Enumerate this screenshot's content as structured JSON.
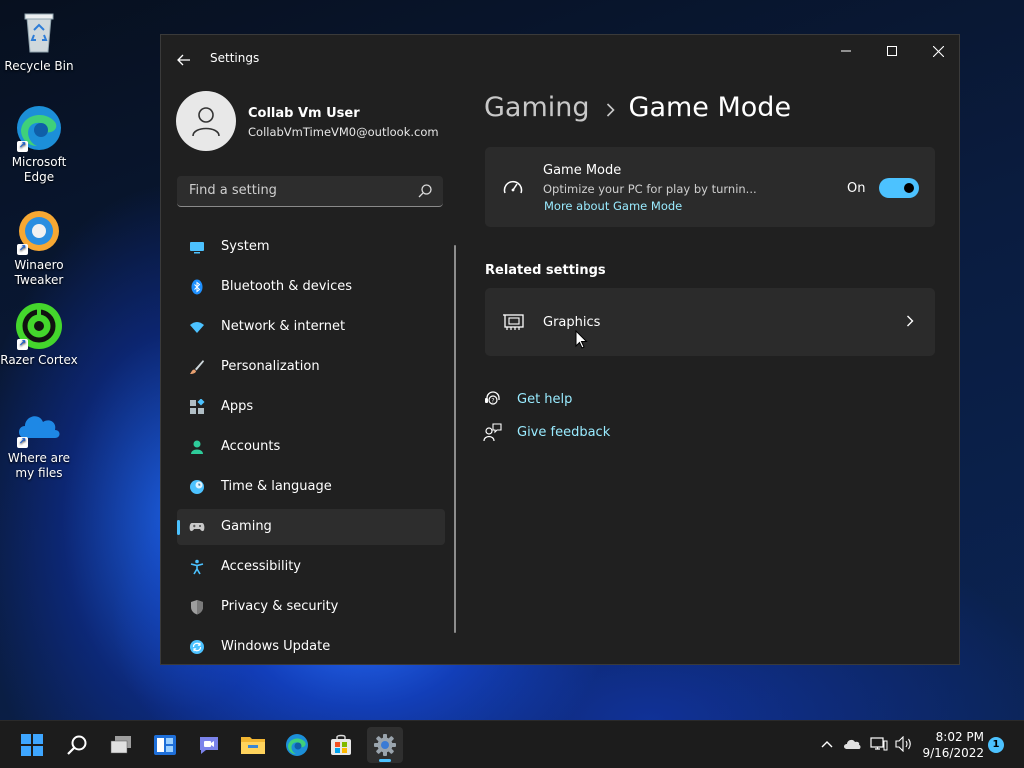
{
  "desktop": {
    "icons": [
      {
        "label": "Recycle Bin"
      },
      {
        "label": "Microsoft Edge"
      },
      {
        "label": "Winaero Tweaker"
      },
      {
        "label": "Razer Cortex"
      },
      {
        "label": "Where are my files"
      }
    ]
  },
  "window": {
    "title": "Settings",
    "profile": {
      "name": "Collab Vm User",
      "email": "CollabVmTimeVM0@outlook.com"
    },
    "search": {
      "placeholder": "Find a setting"
    },
    "nav": [
      {
        "label": "System",
        "icon": "monitor-icon",
        "color": "#4cc2ff"
      },
      {
        "label": "Bluetooth & devices",
        "icon": "bluetooth-icon",
        "color": "#1e90ff"
      },
      {
        "label": "Network & internet",
        "icon": "wifi-icon",
        "color": "#4cc2ff"
      },
      {
        "label": "Personalization",
        "icon": "brush-icon",
        "color": "#e8a070"
      },
      {
        "label": "Apps",
        "icon": "apps-icon",
        "color": "#b0bec5"
      },
      {
        "label": "Accounts",
        "icon": "person-icon",
        "color": "#2ecc9a"
      },
      {
        "label": "Time & language",
        "icon": "globe-clock-icon",
        "color": "#4cc2ff"
      },
      {
        "label": "Gaming",
        "icon": "gamepad-icon",
        "color": "#c8c8c8",
        "selected": true
      },
      {
        "label": "Accessibility",
        "icon": "accessibility-icon",
        "color": "#4cc2ff"
      },
      {
        "label": "Privacy & security",
        "icon": "shield-icon",
        "color": "#9e9e9e"
      },
      {
        "label": "Windows Update",
        "icon": "update-icon",
        "color": "#4cc2ff"
      }
    ]
  },
  "content": {
    "breadcrumb_parent": "Gaming",
    "breadcrumb_current": "Game Mode",
    "game_mode": {
      "title": "Game Mode",
      "description": "Optimize your PC for play by turnin...",
      "link": "More about Game Mode",
      "toggle_label": "On",
      "toggle_on": true
    },
    "related_title": "Related settings",
    "graphics_label": "Graphics",
    "help_label": "Get help",
    "feedback_label": "Give feedback"
  },
  "taskbar": {
    "time": "8:02 PM",
    "date": "9/16/2022",
    "notification_count": "1"
  },
  "colors": {
    "accent": "#4cc2ff",
    "link": "#99ebff",
    "window_bg": "#202020",
    "card_bg": "#2b2b2b"
  }
}
